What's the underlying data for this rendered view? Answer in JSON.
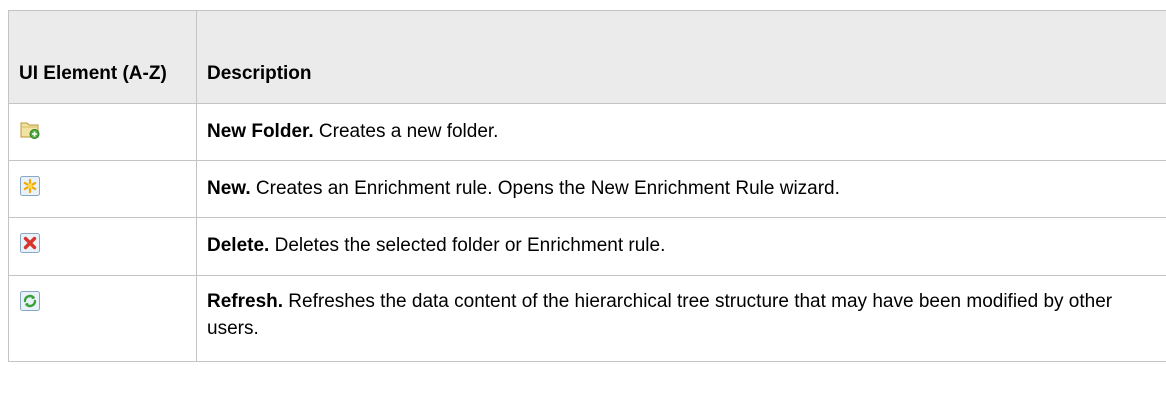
{
  "table": {
    "headers": {
      "element": "UI Element (A-Z)",
      "description": "Description"
    },
    "rows": [
      {
        "icon": "new-folder-icon",
        "term": "New Folder.",
        "text": " Creates a new folder."
      },
      {
        "icon": "new-star-icon",
        "term": "New.",
        "text": " Creates an Enrichment rule. Opens the New Enrichment Rule wizard."
      },
      {
        "icon": "delete-x-icon",
        "term": "Delete.",
        "text": " Deletes the selected folder or Enrichment rule."
      },
      {
        "icon": "refresh-icon",
        "term": "Refresh.",
        "text": " Refreshes the data content of the hierarchical tree structure that may have been modified by other users."
      }
    ]
  },
  "colors": {
    "header_bg": "#ebebeb",
    "border": "#c4c4c4"
  }
}
